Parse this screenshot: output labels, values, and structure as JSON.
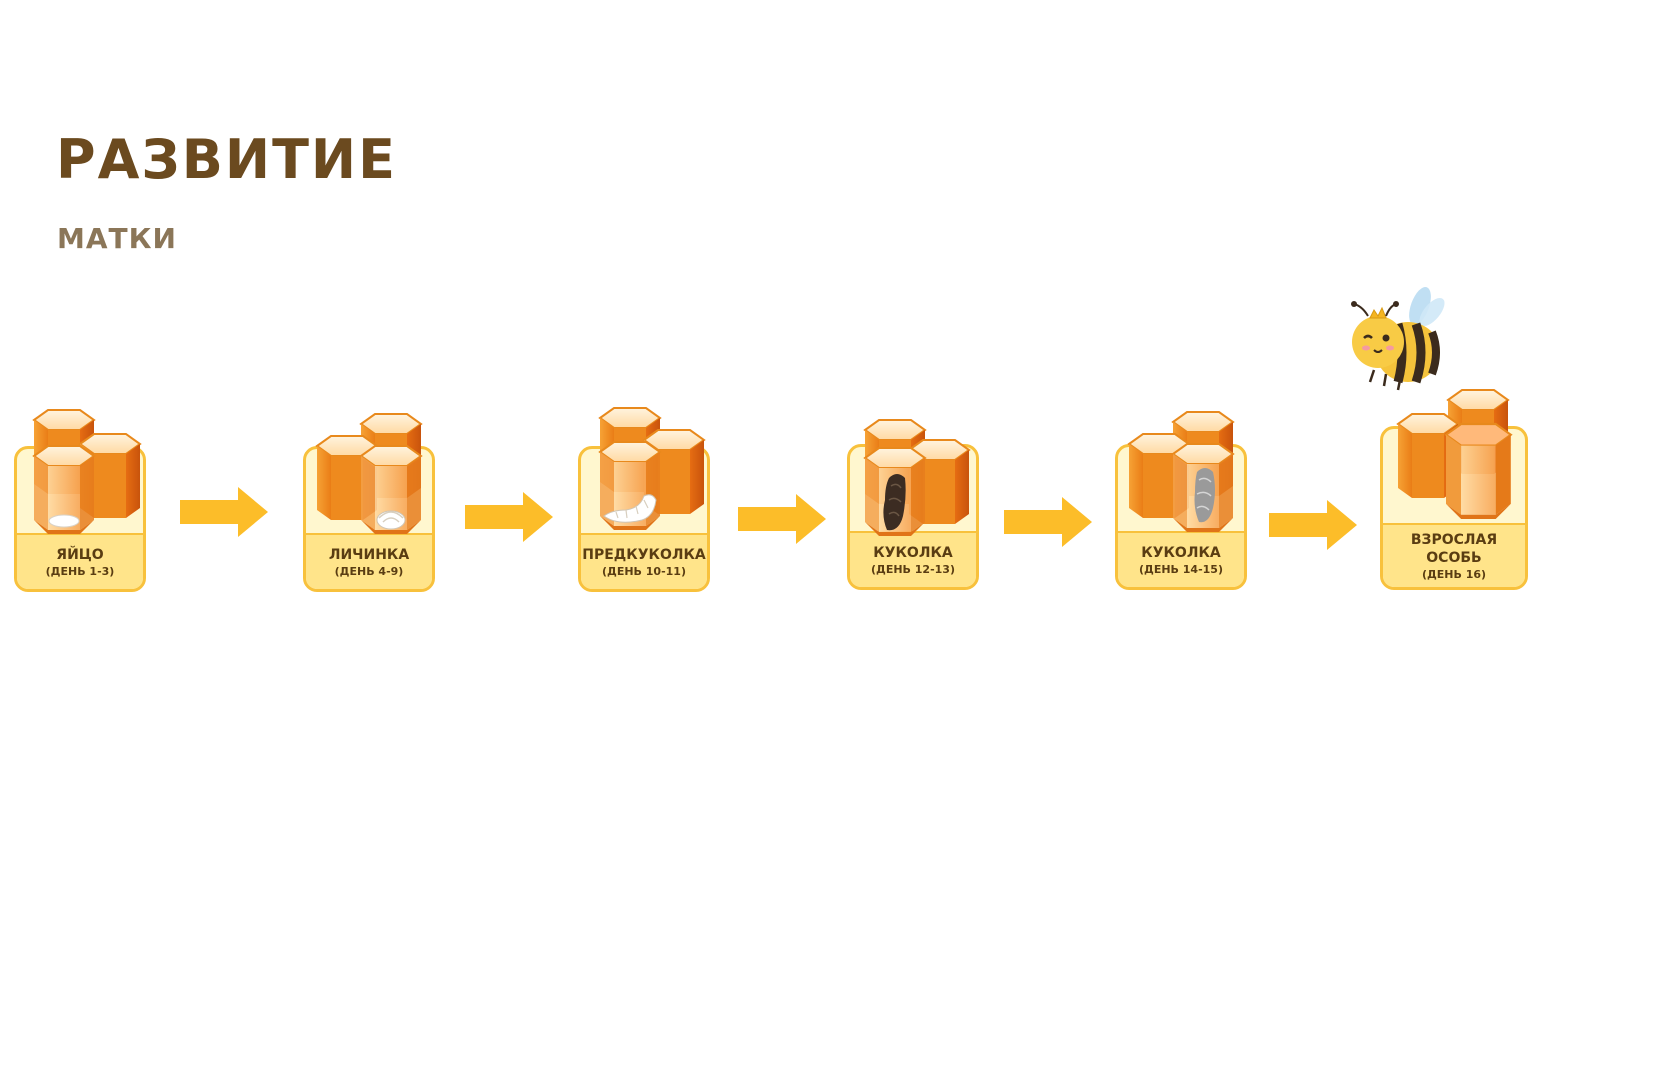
{
  "header": {
    "title": "РАЗВИТИЕ",
    "subtitle": "МАТКИ"
  },
  "colors": {
    "accent": "#f8bd2a",
    "cell_orange": "#f08b1c",
    "cell_dark": "#dd6312",
    "title": "#6b4a1f"
  },
  "stages": [
    {
      "name": "ЯЙЦО",
      "days": "(ДЕНЬ 1-3)",
      "icon": "egg-icon"
    },
    {
      "name": "ЛИЧИНКА",
      "days": "(ДЕНЬ 4-9)",
      "icon": "larva-icon"
    },
    {
      "name": "ПРЕДКУКОЛКА",
      "days": "(ДЕНЬ 10-11)",
      "icon": "prepupa-icon"
    },
    {
      "name": "КУКОЛКА",
      "days": "(ДЕНЬ 12-13)",
      "icon": "dark-pupa-icon"
    },
    {
      "name": "КУКОЛКА",
      "days": "(ДЕНЬ 14-15)",
      "icon": "grey-pupa-icon"
    },
    {
      "name": "ВЗРОСЛАЯ ОСОБЬ",
      "days": "(ДЕНЬ 16)",
      "icon": "queen-bee-icon"
    }
  ]
}
